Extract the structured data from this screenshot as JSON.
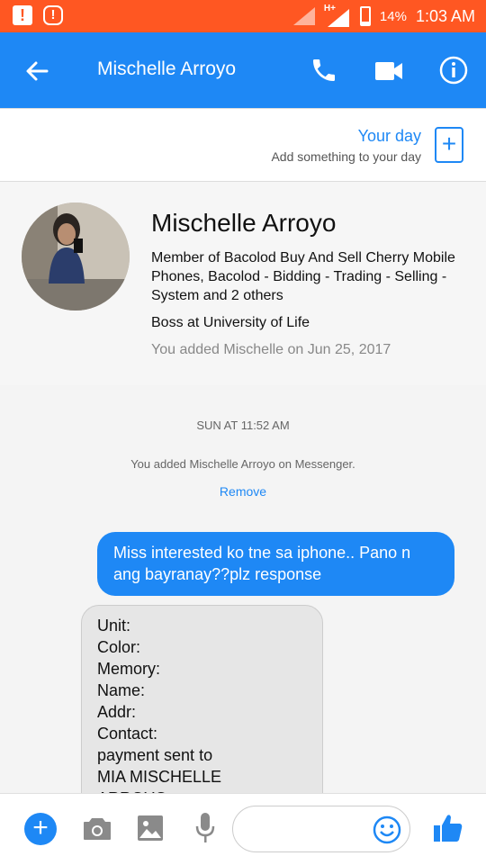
{
  "status_bar": {
    "battery_percent_label": "14%",
    "battery_level": 0.14,
    "time": "1:03 AM",
    "network_label": "H+",
    "alert_icons": [
      "sd-card-alert-icon",
      "warning-icon"
    ]
  },
  "header": {
    "title": "Mischelle Arroyo",
    "icons": [
      "back-arrow-icon",
      "phone-icon",
      "video-camera-icon",
      "info-icon"
    ]
  },
  "your_day": {
    "title": "Your day",
    "subtitle": "Add something to your day",
    "add_symbol": "+"
  },
  "profile": {
    "name": "Mischelle Arroyo",
    "groups": "Member of Bacolod Buy And Sell Cherry Mobile Phones, Bacolod - Bidding - Trading - Selling - System and 2 others",
    "work": "Boss at University of Life",
    "added": "You added Mischelle on Jun 25, 2017"
  },
  "thread": {
    "timestamp": "SUN AT 11:52 AM",
    "system_message": "You added Mischelle Arroyo on Messenger.",
    "remove_label": "Remove",
    "outgoing_message": "Miss interested ko tne sa iphone.. Pano n ang bayranay??plz response",
    "incoming_message": "Unit:\nColor:\nMemory:\nName:\nAddr:\nContact:\npayment sent to\nMIA MISCHELLE\nARROYO"
  },
  "composer": {
    "plus_symbol": "+",
    "input_placeholder": "",
    "icons": [
      "plus-icon",
      "camera-icon",
      "image-icon",
      "microphone-icon",
      "emoji-icon",
      "thumbs-up-icon"
    ]
  },
  "colors": {
    "status_bar": "#ff5722",
    "app_bar": "#1e88f5",
    "outgoing_bubble": "#1e88f5",
    "incoming_bubble": "#e6e6e6"
  }
}
